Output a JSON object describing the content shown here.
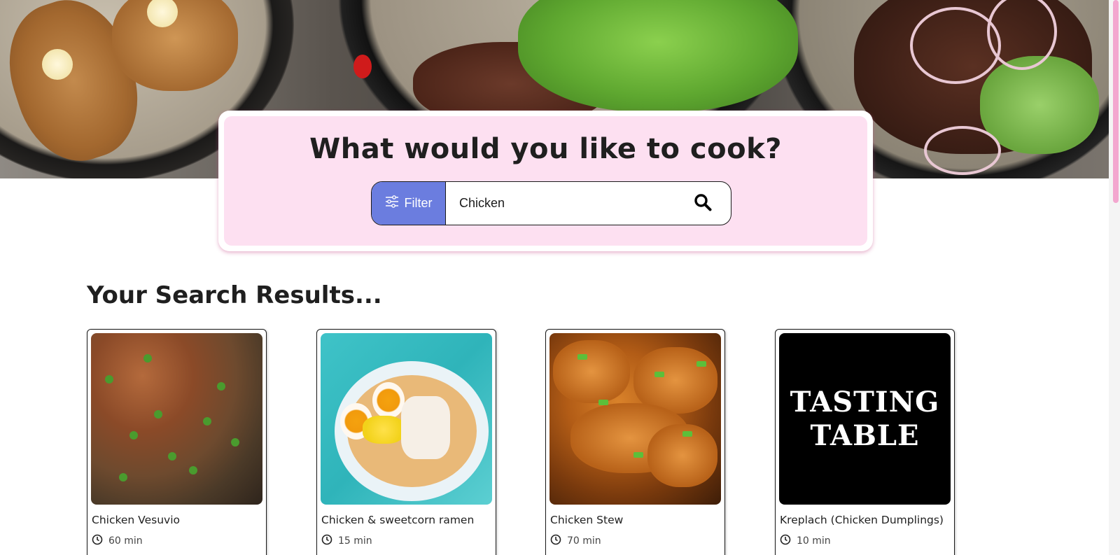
{
  "search": {
    "title": "What would you like to cook?",
    "filter_label": "Filter",
    "query_value": "Chicken",
    "placeholder": ""
  },
  "results": {
    "heading": "Your Search Results...",
    "cards": [
      {
        "title": "Chicken Vesuvio",
        "time": "60 min"
      },
      {
        "title": "Chicken & sweetcorn ramen",
        "time": "15 min"
      },
      {
        "title": "Chicken Stew",
        "time": "70 min"
      },
      {
        "title": "Kreplach (Chicken Dumplings)",
        "time": "10 min",
        "logo_text": [
          "TASTING",
          "TABLE"
        ]
      }
    ]
  },
  "colors": {
    "card_bg": "#fde0f1",
    "filter_bg": "#6b7ddf",
    "scroll_thumb": "#f3a7cf"
  },
  "icons": {
    "filter": "sliders-icon",
    "search": "magnifier-icon",
    "time": "clock-icon"
  }
}
